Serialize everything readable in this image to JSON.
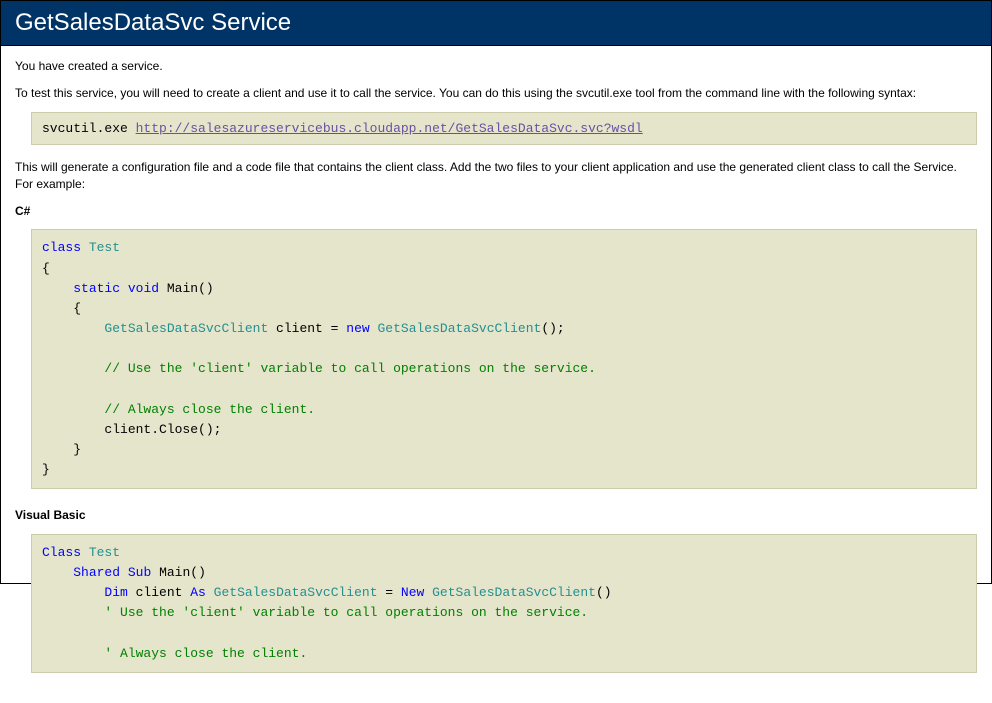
{
  "header": {
    "title": "GetSalesDataSvc Service"
  },
  "intro": {
    "created": "You have created a service.",
    "test_instructions": "To test this service, you will need to create a client and use it to call the service. You can do this using the svcutil.exe tool from the command line with the following syntax:"
  },
  "svcutil": {
    "cmd": "svcutil.exe ",
    "url": "http://salesazureservicebus.cloudapp.net/GetSalesDataSvc.svc?wsdl"
  },
  "after_cmd": "This will generate a configuration file and a code file that contains the client class. Add the two files to your client application and use the generated client class to call the Service. For example:",
  "csharp": {
    "label": "C#",
    "tokens": {
      "class": "class",
      "Test": "Test",
      "ob1": "{",
      "static": "static",
      "void": "void",
      "Main": "Main()",
      "ob2": "{",
      "ClientType": "GetSalesDataSvcClient",
      "clientDecl": " client = ",
      "new": "new",
      "ClientCtor": "GetSalesDataSvcClient",
      "ctorTail": "();",
      "cmt1": "// Use the 'client' variable to call operations on the service.",
      "cmt2": "// Always close the client.",
      "close": "client.Close();",
      "cb2": "}",
      "cb1": "}"
    }
  },
  "vb": {
    "label": "Visual Basic",
    "tokens": {
      "Class": "Class",
      "Test": "Test",
      "Shared": "Shared",
      "Sub": "Sub",
      "Main": "Main()",
      "Dim": "Dim",
      "client": " client ",
      "As": "As",
      "ClientType": "GetSalesDataSvcClient",
      "eq": " = ",
      "New": "New",
      "ClientCtor": "GetSalesDataSvcClient",
      "ctorTail": "()",
      "cmt1": "' Use the 'client' variable to call operations on the service.",
      "cmt2": "' Always close the client."
    }
  }
}
